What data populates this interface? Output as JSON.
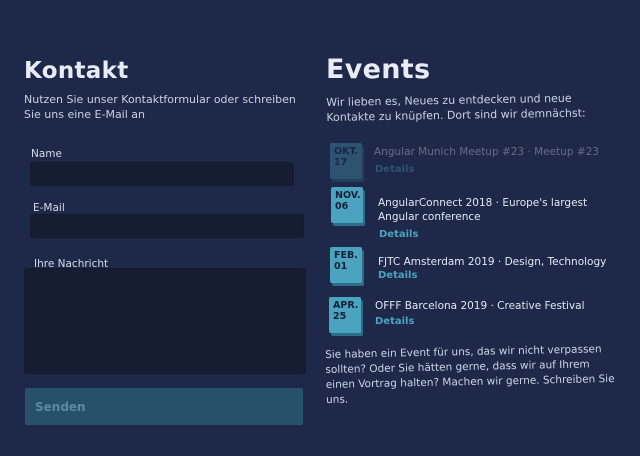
{
  "contact": {
    "title": "Kontakt",
    "intro": "Nutzen Sie unser Kontaktformular oder schreiben Sie uns eine E-Mail an",
    "name_label": "Name",
    "email_label": "E-Mail",
    "message_label": "Ihre Nachricht",
    "submit_label": "Senden"
  },
  "events": {
    "title": "Events",
    "intro": "Wir lieben es, Neues zu entdecken und neue Kontakte zu knüpfen. Dort sind wir demnächst:",
    "items": [
      {
        "month": "OKT.",
        "day": "17",
        "title": "Angular Munich Meetup #23 · Meetup #23",
        "link": "Details"
      },
      {
        "month": "NOV.",
        "day": "06",
        "title": "AngularConnect 2018 · Europe's largest Angular conference",
        "link": "Details"
      },
      {
        "month": "FEB.",
        "day": "01",
        "title": "FJTC Amsterdam 2019 · Design, Technology",
        "link": "Details"
      },
      {
        "month": "APR.",
        "day": "25",
        "title": "OFFF Barcelona 2019 · Creative Festival",
        "link": "Details"
      }
    ],
    "outro": "Sie haben ein Event für uns, das wir nicht verpassen sollten? Oder Sie hätten gerne, dass wir auf Ihrem einen Vortrag halten? Machen wir gerne. Schreiben Sie uns."
  },
  "colors": {
    "background": "#1e2848",
    "accent": "#4ba3bf",
    "button": "#27506b"
  }
}
